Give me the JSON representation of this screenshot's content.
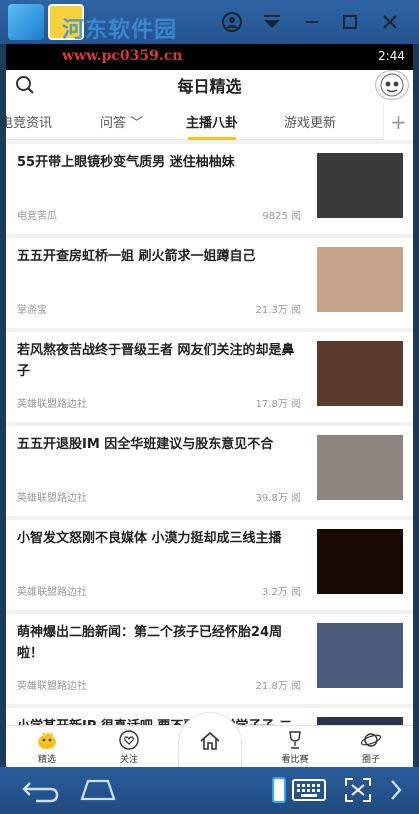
{
  "emulator": {
    "watermark_line1": "河东软件园",
    "watermark_line2": "www.pc0359.cn",
    "clock": "2:44"
  },
  "header": {
    "title": "每日精选"
  },
  "tabs": [
    {
      "label": "电竞资讯"
    },
    {
      "label": "问答"
    },
    {
      "label": "主播八卦",
      "active": true
    },
    {
      "label": "游戏更新"
    }
  ],
  "tab_add_label": "+",
  "articles": [
    {
      "title": "55开带上眼镜秒变气质男 迷住柚柚妹",
      "source": "电竞苦瓜",
      "reads": "9825 阅",
      "thumb_color": "#3a3a3a"
    },
    {
      "title": "五五开查房虹桥一姐 刷火箭求一姐蹲自己",
      "source": "掌游宝",
      "reads": "21.3万 阅",
      "thumb_color": "#c6a28a"
    },
    {
      "title": "若风熬夜苦战终于晋级王者 网友们关注的却是鼻子",
      "source": "英雄联盟路边社",
      "reads": "17.8万 阅",
      "thumb_color": "#5a3a2a"
    },
    {
      "title": "五五开退股IM 因全华班建议与股东意见不合",
      "source": "英雄联盟路边社",
      "reads": "39.8万 阅",
      "thumb_color": "#8d8580"
    },
    {
      "title": "小智发文怒刚不良媒体 小漠力挺却成三线主播",
      "source": "英雄联盟路边社",
      "reads": "3.2万 阅",
      "thumb_color": "#1a0a05"
    },
    {
      "title": "萌神爆出二胎新闻：第二个孩子已经怀胎24周啦！",
      "source": "英雄联盟路边社",
      "reads": "21.8万 阅",
      "thumb_color": "#4a5a7a"
    },
    {
      "title": "小学某开新IP 很真话吧 要不要二学学学子子 二",
      "source": "",
      "reads": "",
      "thumb_color": "#2a3550"
    }
  ],
  "bottom_nav": [
    {
      "label": "精选",
      "icon": "chick-icon"
    },
    {
      "label": "关注",
      "icon": "heart-icon"
    },
    {
      "label": "",
      "icon": "home-icon"
    },
    {
      "label": "看比赛",
      "icon": "trophy-icon"
    },
    {
      "label": "圈子",
      "icon": "planet-icon"
    }
  ]
}
